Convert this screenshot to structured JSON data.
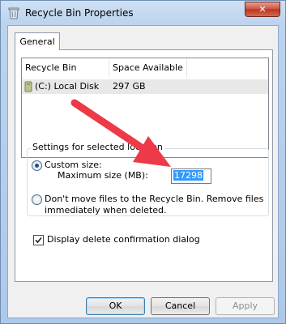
{
  "window": {
    "title": "Recycle Bin Properties",
    "close_symbol": "✕"
  },
  "tabs": [
    {
      "label": "General",
      "active": true
    }
  ],
  "list": {
    "columns": [
      "Recycle Bin Location",
      "Space Available"
    ],
    "rows": [
      {
        "location": "(C:) Local Disk",
        "space": "297 GB",
        "icon": "drive-icon"
      }
    ]
  },
  "settings": {
    "group_label": "Settings for selected location",
    "custom_size_label": "Custom size:",
    "custom_size_checked": true,
    "max_size_label": "Maximum size (MB):",
    "max_size_value": "17298",
    "dont_move_line1": "Don't move files to the Recycle Bin. Remove files",
    "dont_move_line2": "immediately when deleted.",
    "dont_move_checked": false
  },
  "confirm": {
    "label": "Display delete confirmation dialog",
    "checked": true
  },
  "buttons": {
    "ok": "OK",
    "cancel": "Cancel",
    "apply": "Apply"
  },
  "colors": {
    "annotation_arrow": "#ec3a48",
    "selection": "#3399ff"
  }
}
